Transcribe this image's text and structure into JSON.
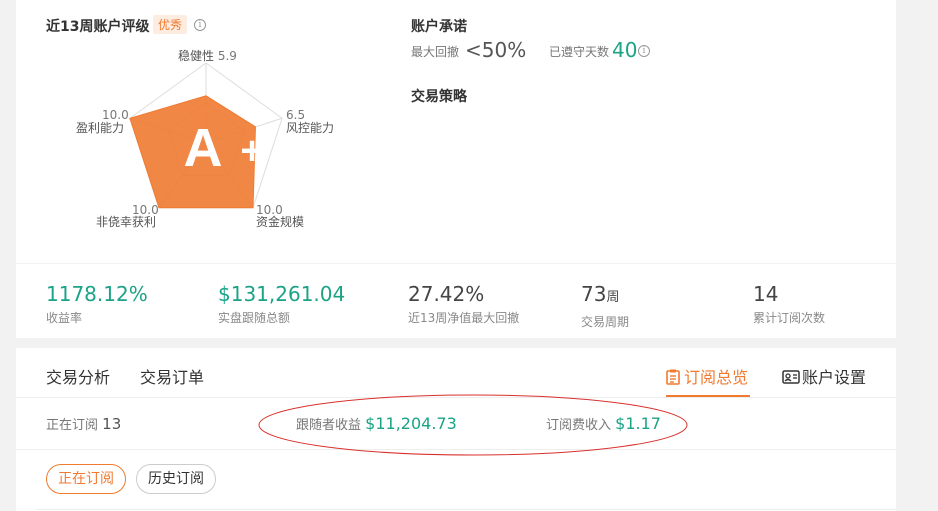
{
  "rating": {
    "title": "近13周账户评级",
    "badge": "优秀",
    "info_glyph": "i",
    "grade_letter": "A",
    "grade_plus": "+",
    "axes": [
      {
        "name": "稳健性",
        "value": "5.9"
      },
      {
        "name": "风控能力",
        "value": "6.5"
      },
      {
        "name": "资金规模",
        "value": "10.0"
      },
      {
        "name": "非侥幸获利",
        "value": "10.0"
      },
      {
        "name": "盈利能力",
        "value": "10.0"
      }
    ],
    "colors": {
      "fill": "#f07a30",
      "grid": "#dddddd"
    }
  },
  "commitment": {
    "title": "账户承诺",
    "max_drawdown_label": "最大回撤",
    "max_drawdown_value": "<50%",
    "days_label": "已遵守天数",
    "days_value": "40",
    "info_glyph": "i"
  },
  "strategy": {
    "title": "交易策略"
  },
  "stats": [
    {
      "value": "1178.12%",
      "unit": "",
      "label": "收益率",
      "style": "green"
    },
    {
      "value": "$131,261.04",
      "unit": "",
      "label": "实盘跟随总额",
      "style": "green"
    },
    {
      "value": "27.42%",
      "unit": "",
      "label": "近13周净值最大回撤",
      "style": "dark"
    },
    {
      "value": "73",
      "unit": "周",
      "label": "交易周期",
      "style": "dark"
    },
    {
      "value": "14",
      "unit": "",
      "label": "累计订阅次数",
      "style": "dark"
    }
  ],
  "tabs": {
    "analysis": "交易分析",
    "orders": "交易订单",
    "overview": "订阅总览",
    "settings": "账户设置"
  },
  "subscription": {
    "current_label": "正在订阅",
    "current_count": "13",
    "follower_income_label": "跟随者收益",
    "follower_income_value": "$11,204.73",
    "fee_income_label": "订阅费收入",
    "fee_income_value": "$1.17"
  },
  "filters": {
    "active": "正在订阅",
    "history": "历史订阅"
  },
  "colors": {
    "accent": "#f07a30",
    "green": "#1aa386",
    "annotation": "#d9302c"
  }
}
